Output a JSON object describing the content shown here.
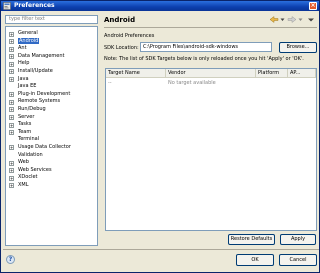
{
  "window": {
    "title": "Preferences"
  },
  "filter": {
    "placeholder": "type filter text"
  },
  "tree": {
    "items": [
      {
        "label": "General",
        "expandable": true,
        "selected": false
      },
      {
        "label": "Android",
        "expandable": true,
        "selected": true
      },
      {
        "label": "Ant",
        "expandable": true,
        "selected": false
      },
      {
        "label": "Data Management",
        "expandable": true,
        "selected": false
      },
      {
        "label": "Help",
        "expandable": true,
        "selected": false
      },
      {
        "label": "Install/Update",
        "expandable": true,
        "selected": false
      },
      {
        "label": "Java",
        "expandable": true,
        "selected": false
      },
      {
        "label": "Java EE",
        "expandable": false,
        "selected": false
      },
      {
        "label": "Plug-in Development",
        "expandable": true,
        "selected": false
      },
      {
        "label": "Remote Systems",
        "expandable": true,
        "selected": false
      },
      {
        "label": "Run/Debug",
        "expandable": true,
        "selected": false
      },
      {
        "label": "Server",
        "expandable": true,
        "selected": false
      },
      {
        "label": "Tasks",
        "expandable": true,
        "selected": false
      },
      {
        "label": "Team",
        "expandable": true,
        "selected": false
      },
      {
        "label": "Terminal",
        "expandable": false,
        "selected": false
      },
      {
        "label": "Usage Data Collector",
        "expandable": true,
        "selected": false
      },
      {
        "label": "Validation",
        "expandable": false,
        "selected": false
      },
      {
        "label": "Web",
        "expandable": true,
        "selected": false
      },
      {
        "label": "Web Services",
        "expandable": true,
        "selected": false
      },
      {
        "label": "XDoclet",
        "expandable": true,
        "selected": false
      },
      {
        "label": "XML",
        "expandable": true,
        "selected": false
      }
    ]
  },
  "page": {
    "title": "Android",
    "section_label": "Android Preferences",
    "sdk_label": "SDK Location:",
    "sdk_value": "C:\\Program Files\\android-sdk-windows",
    "browse_label": "Browse...",
    "note": "Note: The list of SDK Targets below is only reloaded once you hit 'Apply' or 'OK'.",
    "table": {
      "columns": [
        "Target Name",
        "Vendor",
        "Platform",
        "AP..."
      ],
      "rows": [
        [
          "--",
          "No target available",
          "",
          ""
        ]
      ]
    },
    "restore_label": "Restore Defaults",
    "apply_label": "Apply"
  },
  "footer": {
    "ok_label": "OK",
    "cancel_label": "Cancel"
  },
  "icons": {
    "help": "help-icon",
    "back": "back-arrow-icon",
    "forward": "forward-arrow-icon",
    "menu": "view-menu-icon"
  }
}
